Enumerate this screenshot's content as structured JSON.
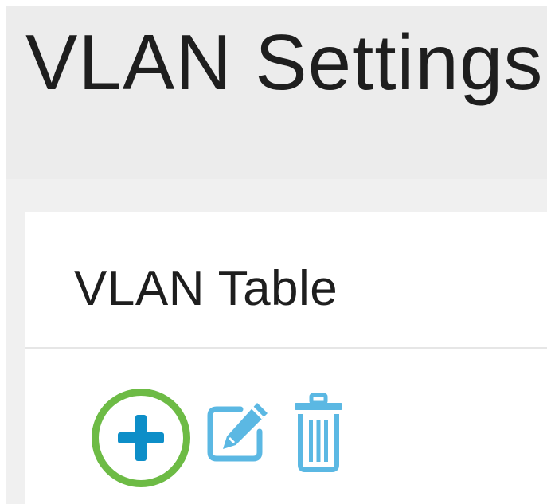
{
  "page": {
    "title": "VLAN Settings"
  },
  "card": {
    "title": "VLAN Table"
  },
  "toolbar": {
    "add_icon": "plus-icon",
    "edit_icon": "edit-icon",
    "delete_icon": "trash-icon",
    "add_highlighted": true
  },
  "colors": {
    "icon_blue": "#0d8ec8",
    "icon_light_blue": "#5bb8e3",
    "highlight_green": "#6dbb45",
    "header_bg": "#ececec",
    "title_text": "#1e1e1e"
  }
}
